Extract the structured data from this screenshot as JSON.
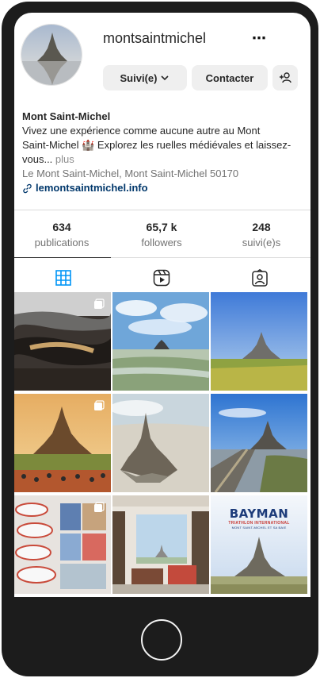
{
  "profile": {
    "username": "montsaintmichel",
    "more_icon": "⋯"
  },
  "actions": {
    "follow_label": "Suivi(e)",
    "contact_label": "Contacter"
  },
  "bio": {
    "name": "Mont Saint-Michel",
    "text_line1": "Vivez une expérience comme aucune autre au Mont",
    "text_line2": "Saint-Michel 🏰 Explorez les ruelles médiévales et laissez-",
    "text_line3": "vous...",
    "more": "plus",
    "address": "Le Mont Saint-Michel, Mont Saint-Michel 50170",
    "link": "lemontsaintmichel.info"
  },
  "stats": [
    {
      "value": "634",
      "label": "publications"
    },
    {
      "value": "65,7 k",
      "label": "followers"
    },
    {
      "value": "248",
      "label": "suivi(e)s"
    }
  ],
  "tabs": [
    "grid-icon",
    "reels-icon",
    "tagged-icon"
  ],
  "colors": {
    "accent": "#0095f6",
    "link": "#00376b",
    "button_bg": "#efefef",
    "phone_frame": "#1c1c1c"
  },
  "grid": {
    "tile7_overlay_title": "BAYMAN",
    "tile7_overlay_sub": "TRIATHLON INTERNATIONAL",
    "tile7_overlay_sub2": "MONT SAINT-MICHEL ET SA BAIE"
  }
}
